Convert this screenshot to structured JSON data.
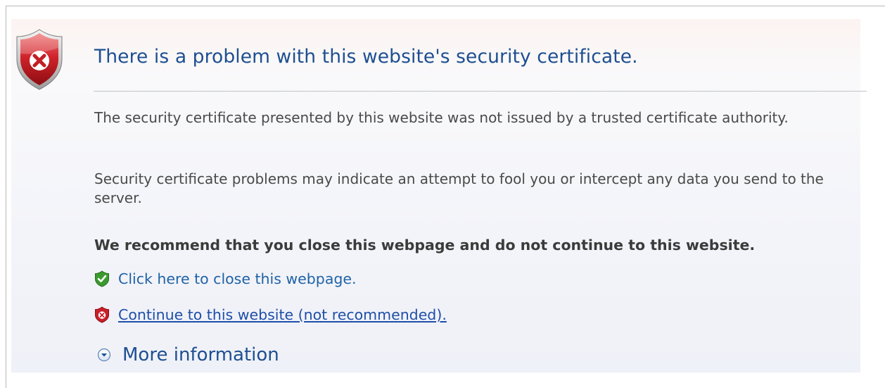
{
  "error": {
    "title": "There is a problem with this website's security certificate.",
    "paragraph1": "The security certificate presented by this website was not issued by a trusted certificate authority.",
    "paragraph2": "Security certificate problems may indicate an attempt to fool you or intercept any data you send to the server.",
    "recommendation": "We recommend that you close this webpage and do not continue to this website.",
    "close_link": "Click here to close this webpage.",
    "continue_link": "Continue to this website (not recommended).",
    "more_info": "More information"
  },
  "icons": {
    "header": "shield-error-icon",
    "close": "shield-check-icon",
    "continue": "shield-x-icon",
    "more": "expand-circle-icon"
  },
  "colors": {
    "title": "#1d4f91",
    "link": "#1f62a6",
    "shield_red": "#c8202a",
    "shield_green": "#3a9a2e"
  }
}
